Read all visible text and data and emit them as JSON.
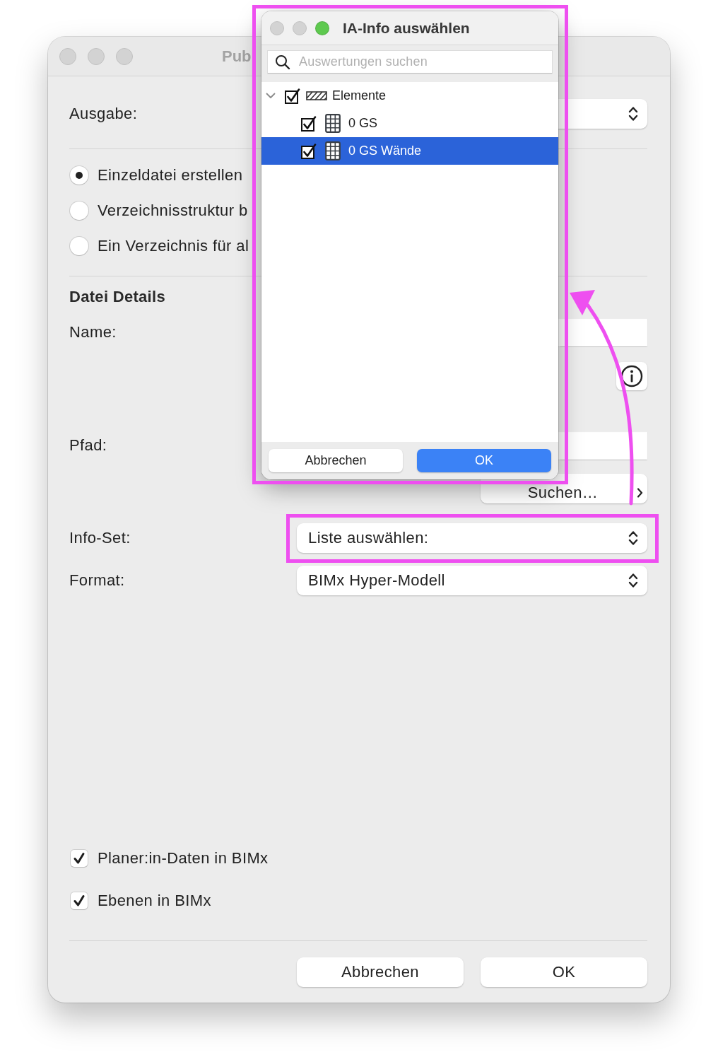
{
  "main_window": {
    "title": "Pub",
    "window_buttons": [
      {
        "enabled": false
      },
      {
        "enabled": false
      },
      {
        "enabled": false
      }
    ]
  },
  "ausgabe": {
    "label": "Ausgabe:"
  },
  "output_mode": [
    {
      "label": "Einzeldatei erstellen",
      "selected": true
    },
    {
      "label": "Verzeichnisstruktur b",
      "selected": false
    },
    {
      "label": "Ein Verzeichnis für al",
      "selected": false
    }
  ],
  "file_details": {
    "heading": "Datei Details",
    "name_label": "Name:",
    "path_label": "Pfad:",
    "browse_button": "Suchen…"
  },
  "info_set": {
    "label": "Info-Set:",
    "value": "Liste auswählen:"
  },
  "format": {
    "label": "Format:",
    "value": "BIMx Hyper-Modell"
  },
  "options": [
    {
      "label": "Planer:in-Daten in BIMx",
      "checked": true
    },
    {
      "label": "Ebenen in BIMx",
      "checked": true
    }
  ],
  "buttons": [
    "Abbrechen",
    "OK"
  ],
  "dialog": {
    "title": "IA-Info auswählen",
    "window_buttons": [
      {
        "enabled": false
      },
      {
        "enabled": false
      },
      {
        "enabled": true
      }
    ],
    "search": {
      "placeholder": "Auswertungen suchen"
    },
    "tree": [
      {
        "label": "Elemente",
        "kind": "group",
        "checked": true,
        "expanded": true,
        "selected": false,
        "children": [
          {
            "label": "0 GS",
            "kind": "sheet",
            "checked": true,
            "selected": false
          },
          {
            "label": "0 GS Wände",
            "kind": "sheet",
            "checked": true,
            "selected": true
          }
        ]
      }
    ],
    "buttons": [
      {
        "label": "Abbrechen",
        "default": false
      },
      {
        "label": "OK",
        "default": true
      }
    ]
  }
}
